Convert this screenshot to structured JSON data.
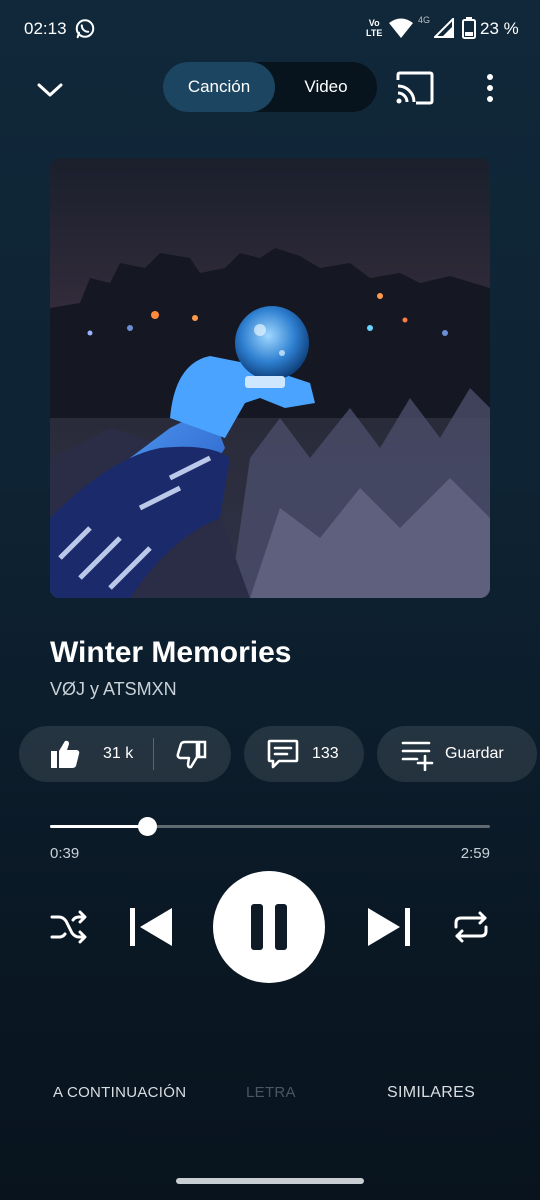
{
  "status_bar": {
    "time": "02:13",
    "volte": "Vo\nLTE",
    "network": "4G",
    "battery": "23 %"
  },
  "header": {
    "toggle_song": "Canción",
    "toggle_video": "Video"
  },
  "song": {
    "title": "Winter Memories",
    "artist": "VØJ y ATSMXN"
  },
  "actions": {
    "likes": "31 k",
    "comments": "133",
    "save": "Guardar"
  },
  "progress": {
    "current": "0:39",
    "total": "2:59",
    "fraction": 0.22
  },
  "tabs": {
    "up_next": "A CONTINUACIÓN",
    "lyrics": "LETRA",
    "related": "SIMILARES"
  },
  "colors": {
    "accent_toggle": "#1b4560",
    "background": "#0e2333"
  },
  "icons": [
    "whatsapp-icon",
    "wifi-icon",
    "signal-icon",
    "battery-icon",
    "chevron-down-icon",
    "cast-icon",
    "more-vert-icon",
    "thumb-up-icon",
    "thumb-down-icon",
    "comment-icon",
    "playlist-add-icon",
    "shuffle-icon",
    "skip-previous-icon",
    "pause-icon",
    "skip-next-icon",
    "repeat-icon"
  ]
}
